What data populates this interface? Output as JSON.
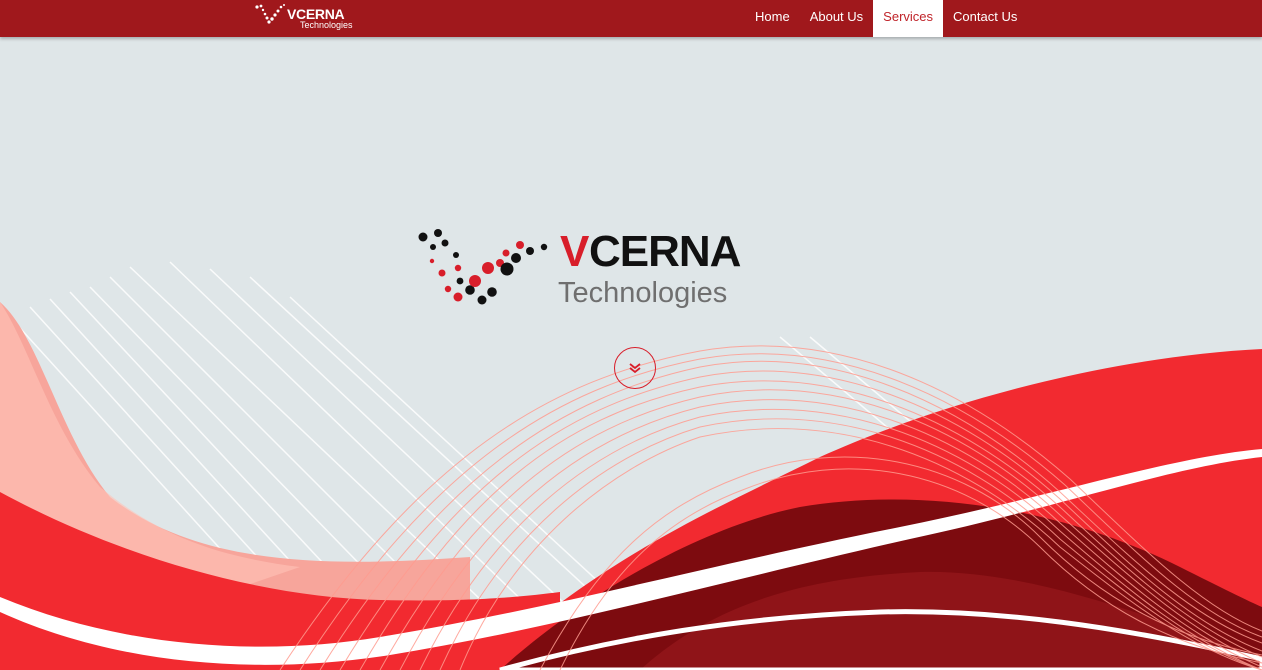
{
  "navbar": {
    "logo": {
      "brand": "VCERNA",
      "sub": "Technologies"
    },
    "items": [
      {
        "label": "Home",
        "active": false
      },
      {
        "label": "About Us",
        "active": false
      },
      {
        "label": "Services",
        "active": true
      },
      {
        "label": "Contact Us",
        "active": false
      }
    ]
  },
  "hero": {
    "logo": {
      "v_letter": "V",
      "rest": "CERNA",
      "tagline": "Technologies"
    },
    "scroll_icon": "double-chevron-down-icon"
  },
  "colors": {
    "nav_bg": "#a0181c",
    "brand_red": "#d81e2a",
    "hero_bg": "#dfe6e8",
    "wave_red": "#f22a30",
    "wave_dark": "#8a1014"
  }
}
